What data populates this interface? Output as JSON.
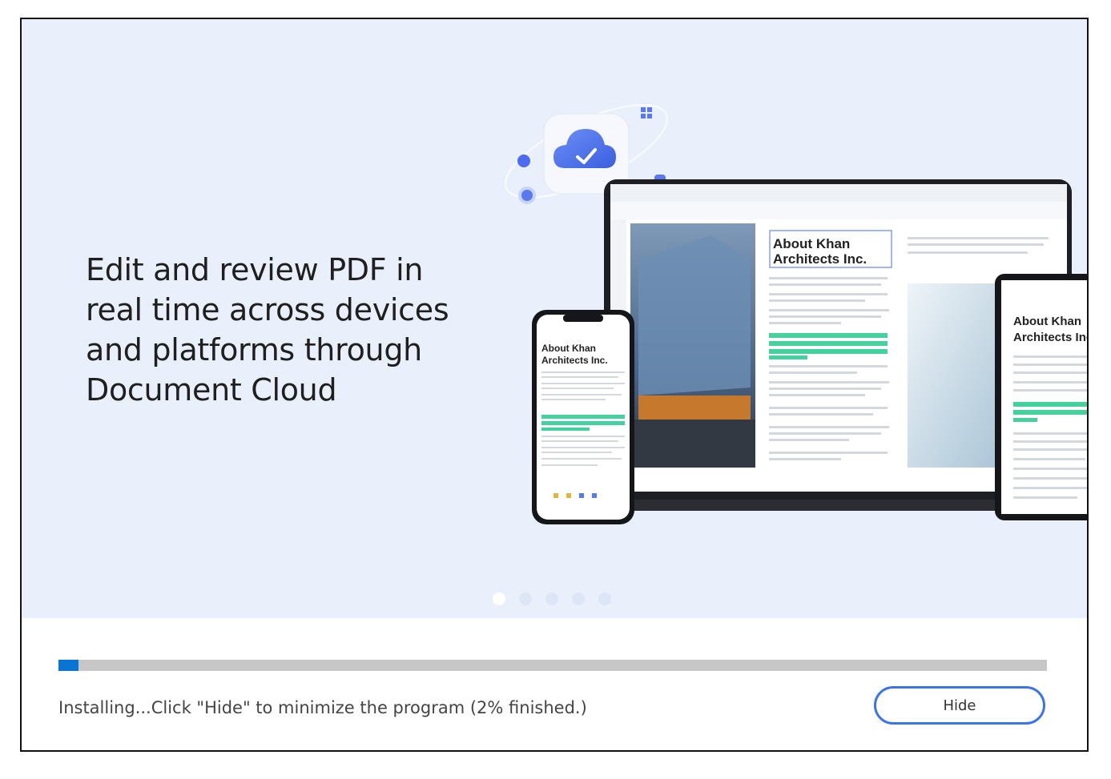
{
  "hero": {
    "headline_lines": [
      "Edit and review PDF in",
      "real time across devices",
      "and platforms through",
      "Document Cloud"
    ],
    "slides": {
      "count": 5,
      "active_index": 0
    },
    "mockup": {
      "laptop_doc_title_1": "About Khan",
      "laptop_doc_title_2": "Architects Inc.",
      "phone_doc_title_1": "About Khan",
      "phone_doc_title_2": "Architects Inc.",
      "tablet_doc_title_1": "About Khan",
      "tablet_doc_title_2": "Architects Inc"
    }
  },
  "footer": {
    "progress_percent": 2,
    "status_text": "Installing...Click \"Hide\" to minimize the program (2% finished.)",
    "hide_label": "Hide"
  },
  "colors": {
    "hero_bg": "#e9f0fc",
    "accent": "#3b73e8",
    "progress_fill": "#0a74d6",
    "progress_track": "#c7c7c7",
    "highlight": "#43d19e"
  }
}
